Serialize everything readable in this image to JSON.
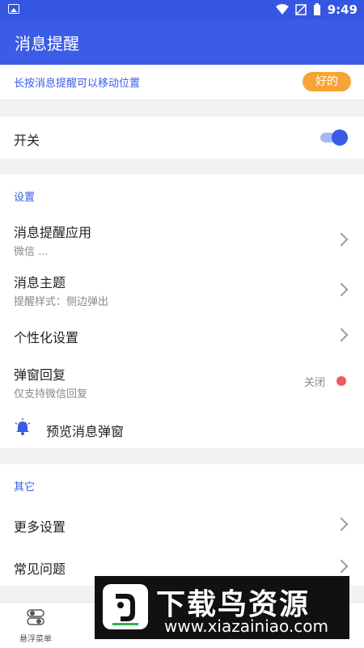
{
  "status_bar": {
    "time": "9:49"
  },
  "header": {
    "title": "消息提醒"
  },
  "tip": {
    "text": "长按消息提醒可以移动位置",
    "button": "好的"
  },
  "switch": {
    "label": "开关",
    "enabled": true
  },
  "settings": {
    "caption": "设置",
    "items": [
      {
        "title": "消息提醒应用",
        "subtitle": "微信 ..."
      },
      {
        "title": "消息主题",
        "subtitle": "提醒样式：侧边弹出"
      },
      {
        "title": "个性化设置"
      },
      {
        "title": "弹窗回复",
        "subtitle": "仅支持微信回复",
        "status": "关闭"
      },
      {
        "title": "预览消息弹窗"
      }
    ]
  },
  "other": {
    "caption": "其它",
    "items": [
      {
        "title": "更多设置"
      },
      {
        "title": "常见问题"
      }
    ]
  },
  "bottom_nav": {
    "tab_label": "悬浮菜单"
  },
  "watermark": {
    "title": "下载鸟资源",
    "url": "www.xiazainiao.com"
  },
  "colors": {
    "primary": "#3a5ce6",
    "accent_orange": "#f7a437",
    "status_red": "#f05b5b"
  }
}
